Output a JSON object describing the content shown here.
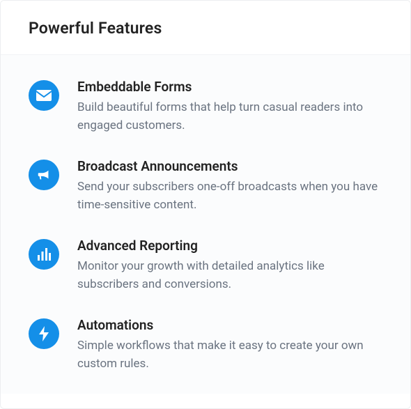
{
  "header": {
    "title": "Powerful Features"
  },
  "features": [
    {
      "icon": "mail-icon",
      "title": "Embeddable Forms",
      "desc": "Build beautiful forms that help turn casual readers into engaged customers."
    },
    {
      "icon": "megaphone-icon",
      "title": "Broadcast Announcements",
      "desc": "Send your subscribers one-off broadcasts when you have time-sensitive content."
    },
    {
      "icon": "chart-icon",
      "title": "Advanced Reporting",
      "desc": "Monitor your growth with detailed analytics like subscribers and conversions."
    },
    {
      "icon": "bolt-icon",
      "title": "Automations",
      "desc": "Simple workflows that make it easy to create your own custom rules."
    }
  ]
}
